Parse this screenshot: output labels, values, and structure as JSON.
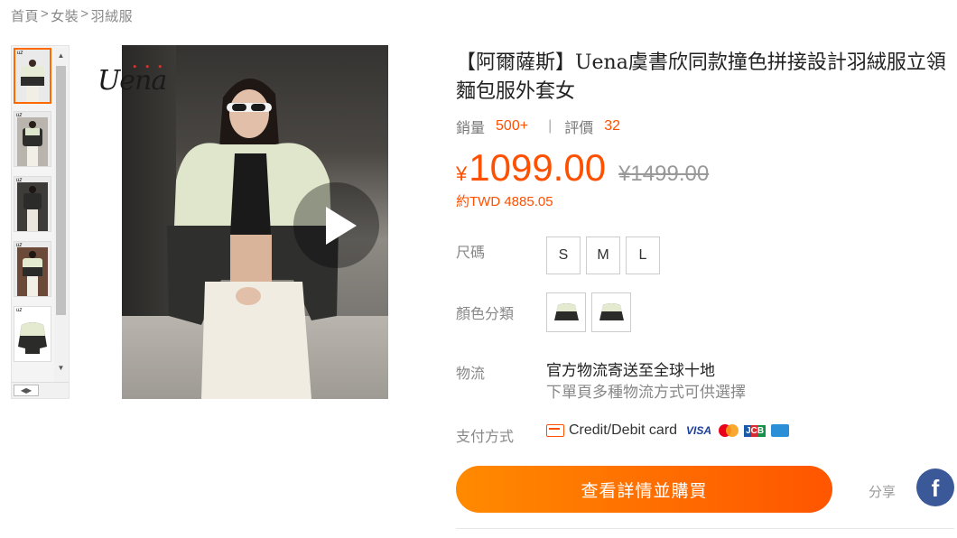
{
  "breadcrumb": [
    "首頁",
    "女裝",
    "羽絨服"
  ],
  "breadcrumb_sep": ">",
  "gallery": {
    "brand_logo": "Uena",
    "thumb_logo": "uz",
    "thumbs": [
      {
        "id": 1,
        "active": true
      },
      {
        "id": 2,
        "active": false
      },
      {
        "id": 3,
        "active": false
      },
      {
        "id": 4,
        "active": false
      },
      {
        "id": 5,
        "active": false
      }
    ],
    "scroll_up_icon": "triangle-up-icon",
    "scroll_down_icon": "triangle-down-icon",
    "scroll_left_icon": "triangle-left-icon",
    "scroll_right_icon": "triangle-right-icon",
    "play_icon": "play-icon"
  },
  "product": {
    "title": "【阿爾薩斯】Uena虞書欣同款撞色拼接設計羽絨服立領麵包服外套女",
    "sales_label": "銷量",
    "sales_value": "500+",
    "stat_separator": "|",
    "reviews_label": "評價",
    "reviews_value": "32",
    "currency": "¥",
    "price": "1099.00",
    "original_price": "¥1499.00",
    "approx_price": "約TWD 4885.05"
  },
  "options": {
    "size_label": "尺碼",
    "sizes": [
      "S",
      "M",
      "L"
    ],
    "color_label": "顏色分類",
    "shipping_label": "物流",
    "shipping_main": "官方物流寄送至全球十地",
    "shipping_sub": "下單頁多種物流方式可供選擇",
    "payment_label": "支付方式",
    "payment_text": "Credit/Debit card",
    "payment_visa": "VISA",
    "payment_jcb": "JCB"
  },
  "actions": {
    "buy_label": "查看詳情並購買",
    "share_label": "分享",
    "facebook_glyph": "f"
  },
  "colors": {
    "accent": "#ff5000",
    "button_start": "#ff8a00",
    "button_end": "#ff5500",
    "facebook": "#3b5998"
  }
}
